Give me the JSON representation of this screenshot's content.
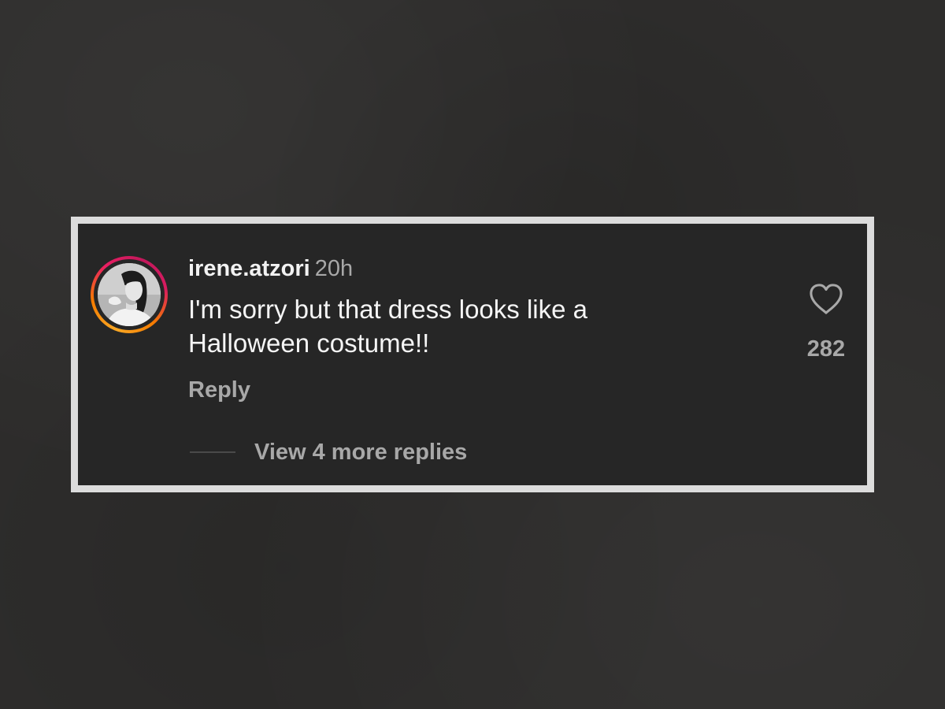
{
  "comment": {
    "username": "irene.atzori",
    "timestamp": "20h",
    "text": "I'm sorry but that dress looks like a Halloween costume!!",
    "reply_label": "Reply",
    "view_replies_label": "View 4 more replies",
    "like_count": "282"
  },
  "icons": {
    "like": "heart-outline-icon",
    "avatar": "profile-photo"
  },
  "colors": {
    "background": "#2e2d2c",
    "card_background": "#262626",
    "card_border": "#dcdcdc",
    "primary_text": "#f2f2f2",
    "secondary_text": "#a8a8a8",
    "story_ring_start": "#f9a825",
    "story_ring_end": "#d81b60"
  }
}
